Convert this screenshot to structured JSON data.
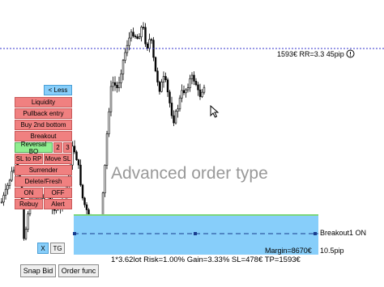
{
  "top_level": {
    "level_info": "1593€  RR=3.3  45pip",
    "info_icon": "info-circle-icon"
  },
  "watermark": "Advanced order type",
  "panel": {
    "less_label": "< Less",
    "buttons": [
      {
        "label": "Liquidity",
        "style": "red"
      },
      {
        "label": "Pullback entry",
        "style": "red"
      },
      {
        "label": "Buy 2nd bottom",
        "style": "red"
      },
      {
        "label": "Breakout",
        "style": "red"
      },
      {
        "label": "Reversal BO",
        "style": "green"
      },
      {
        "label": "2",
        "style": "red"
      },
      {
        "label": "3",
        "style": "red"
      },
      {
        "label": "SL to RP",
        "style": "red"
      },
      {
        "label": "Move SL",
        "style": "red"
      },
      {
        "label": "Surrender",
        "style": "red"
      },
      {
        "label": "Delete/Fresh",
        "style": "red"
      },
      {
        "label": "ON",
        "style": "red"
      },
      {
        "label": "OFF",
        "style": "red"
      },
      {
        "label": "Rebuy",
        "style": "red"
      },
      {
        "label": "Alert",
        "style": "red"
      }
    ],
    "x_label": "X",
    "tg_label": "TG"
  },
  "zone": {
    "breakout_label": "Breakout1 ON",
    "pips_label": "10.5pip",
    "margin_label": "Margin=8670€",
    "summary": "1*3.62lot  Risk=1.00%  Gain=3.33%  SL=478€  TP=1593€"
  },
  "bottom_buttons": {
    "snap_bid": "Snap Bid",
    "order_func": "Order func"
  },
  "colors": {
    "button_red": "#f08080",
    "button_green": "#90ee90",
    "button_blue": "#87cefa",
    "zone_blue": "#87cefa",
    "level_line": "#3333cc"
  }
}
